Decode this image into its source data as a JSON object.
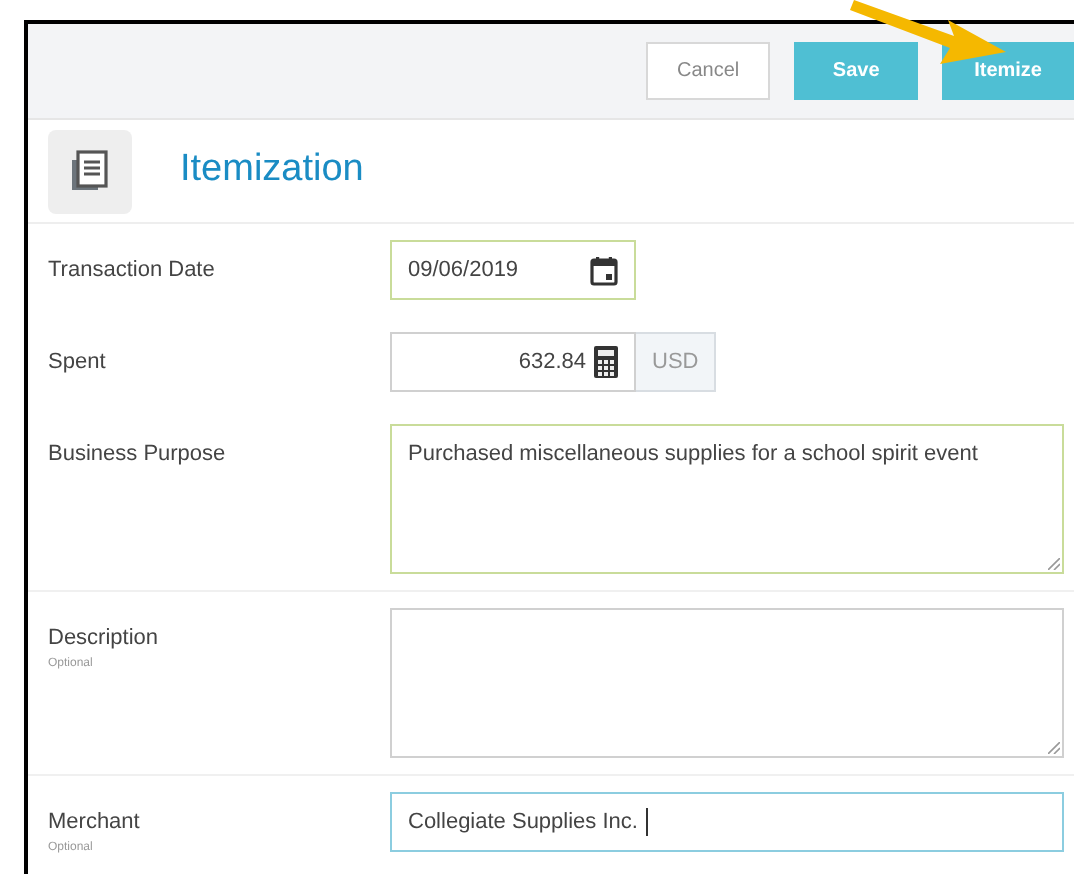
{
  "toolbar": {
    "buttons": [
      {
        "label": "Cancel",
        "kind": "secondary"
      },
      {
        "label": "Save",
        "kind": "primary"
      },
      {
        "label": "Itemize",
        "kind": "primary"
      }
    ]
  },
  "header": {
    "title": "Itemization"
  },
  "fields": [
    {
      "label": "Transaction Date",
      "kind": "date",
      "value": "09/06/2019",
      "valid": true,
      "focused": false
    },
    {
      "label": "Spent",
      "kind": "amount",
      "value": "632.84",
      "currency": "USD",
      "valid": false,
      "focused": false
    },
    {
      "label": "Business Purpose",
      "kind": "textarea",
      "value": "Purchased miscellaneous supplies for a school spirit event",
      "valid": true,
      "focused": false
    },
    {
      "label": "Description",
      "hint": "Optional",
      "kind": "textarea",
      "valid": false,
      "focused": false
    },
    {
      "label": "Merchant",
      "hint": "Optional",
      "kind": "text",
      "value": "Collegiate Supplies Inc.",
      "focused": true
    }
  ]
}
